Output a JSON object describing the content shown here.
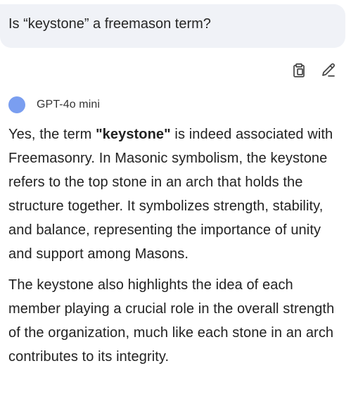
{
  "user_message": {
    "text": "Is “keystone” a freemason term?"
  },
  "message_actions": {
    "copy_icon": "copy-icon",
    "edit_icon": "pencil-icon"
  },
  "model": {
    "name": "GPT-4o mini",
    "dot_color": "#7a9ef0"
  },
  "answer": {
    "p1": {
      "before": "Yes, the term ",
      "bold": "\"keystone\"",
      "after": " is indeed associated with Freemasonry. In Masonic symbolism, the keystone refers to the top stone in an arch that holds the structure together. It symbolizes strength, stability, and balance, representing the importance of unity and support among Masons."
    },
    "p2": "The keystone also highlights the idea of each member playing a crucial role in the overall strength of the organization, much like each stone in an arch contributes to its integrity."
  }
}
